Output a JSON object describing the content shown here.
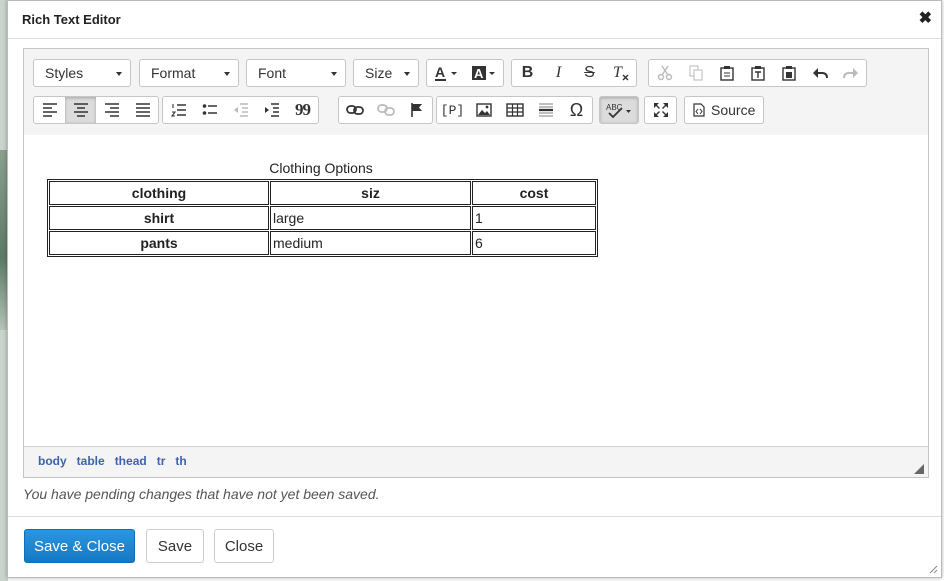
{
  "dialog": {
    "title": "Rich Text Editor",
    "close_glyph": "✖"
  },
  "toolbar": {
    "combos": [
      {
        "id": "styles",
        "label": "Styles"
      },
      {
        "id": "format",
        "label": "Format"
      },
      {
        "id": "font",
        "label": "Font"
      },
      {
        "id": "size",
        "label": "Size"
      }
    ],
    "source_label": "Source",
    "bold": "B",
    "italic": "I",
    "strike": "S",
    "paragraph_tag": "[P]",
    "omega": "Ω",
    "quote": "99",
    "text_color_letter": "A",
    "bg_color_letter": "A",
    "remove_format": "T",
    "spell_glyph": "ABC"
  },
  "table": {
    "caption": "Clothing Options",
    "headers": [
      "clothing",
      "siz",
      "cost"
    ],
    "rows": [
      {
        "name": "shirt",
        "size": "large",
        "cost": "1"
      },
      {
        "name": "pants",
        "size": "medium",
        "cost": "6"
      }
    ]
  },
  "statusbar": {
    "path": [
      "body",
      "table",
      "thead",
      "tr",
      "th"
    ]
  },
  "pending_message": "You have pending changes that have not yet been saved.",
  "buttons": {
    "save_close": "Save & Close",
    "save": "Save",
    "close": "Close"
  },
  "colors": {
    "primary": "#1a86d6",
    "path_link": "#3d63b0"
  }
}
